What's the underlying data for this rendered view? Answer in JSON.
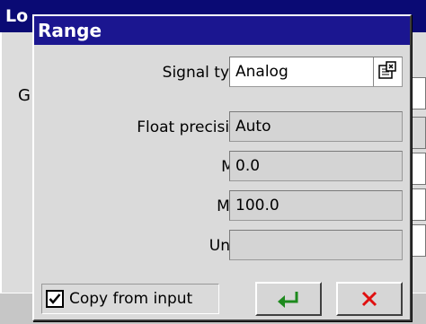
{
  "background_window": {
    "title": "Lo",
    "label": "G"
  },
  "dialog": {
    "title": "Range",
    "fields": [
      {
        "label": "Signal type:",
        "value": "Analog"
      },
      {
        "label": "Float precision:",
        "value": "Auto"
      },
      {
        "label": "Min:",
        "value": "0.0"
      },
      {
        "label": "Max:",
        "value": "100.0"
      },
      {
        "label": "Units:",
        "value": ""
      }
    ],
    "copy_from_input": {
      "label": "Copy from input",
      "checked": true
    },
    "ok_icon": "enter-arrow-icon",
    "cancel_icon": "red-x-icon"
  },
  "colors": {
    "title_bar": "#1b1690",
    "ok_green": "#1e8a1e",
    "cancel_red": "#e01010"
  }
}
